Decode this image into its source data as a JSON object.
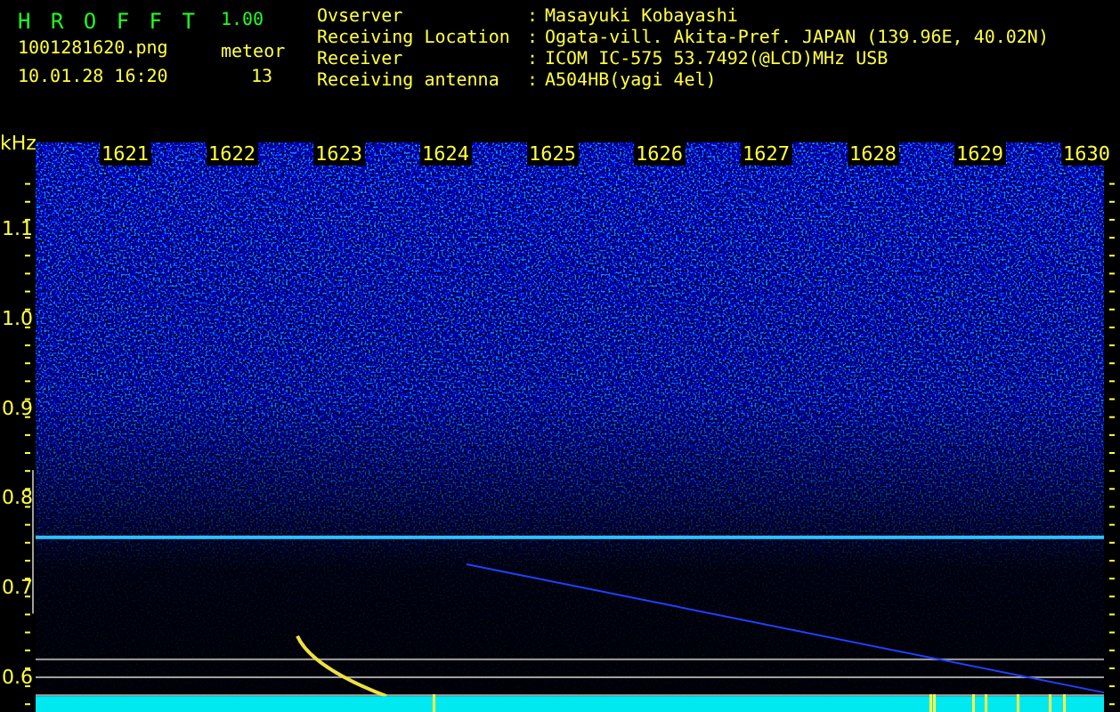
{
  "app": {
    "name": "H R O F F T",
    "version": "1.00"
  },
  "file": "1001281620.png",
  "timestamp": "10.01.28 16:20",
  "meteor": {
    "label": "meteor",
    "count": "13"
  },
  "station": [
    {
      "label": "Ovserver",
      "separator": ":",
      "value": "Masayuki Kobayashi"
    },
    {
      "label": "Receiving Location",
      "separator": ":",
      "value": "Ogata-vill. Akita-Pref. JAPAN (139.96E, 40.02N)"
    },
    {
      "label": "Receiver",
      "separator": ":",
      "value": "ICOM IC-575 53.7492(@LCD)MHz USB"
    },
    {
      "label": "Receiving antenna",
      "separator": ":",
      "value": "A504HB(yagi 4el)"
    }
  ],
  "spectrogram": {
    "unit": "kHz",
    "time_labels": [
      "1621",
      "1622",
      "1623",
      "1624",
      "1625",
      "1626",
      "1627",
      "1628",
      "1629",
      "1630"
    ],
    "freq_labels": [
      "1.1",
      "1.0",
      "0.9",
      "0.8",
      "0.7",
      "0.6"
    ]
  }
}
